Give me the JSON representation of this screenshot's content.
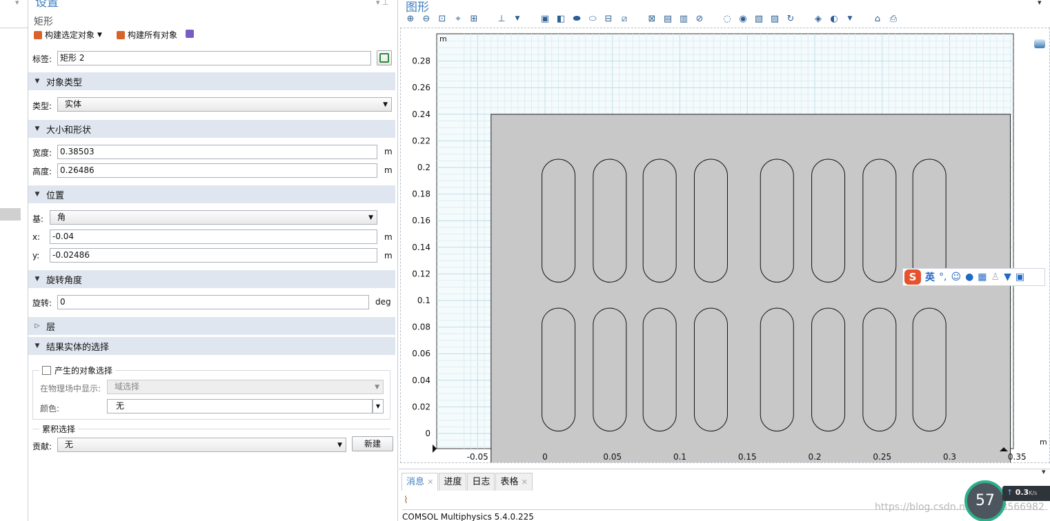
{
  "left_panel": {
    "collapse_glyph": "▾"
  },
  "settings": {
    "title": "设置",
    "subtitle": "矩形",
    "toolbar": {
      "build_selected": "构建选定对象",
      "build_all": "构建所有对象"
    },
    "label_field": {
      "label": "标签:",
      "value": "矩形 2"
    },
    "sections": {
      "object_type": "对象类型",
      "size_shape": "大小和形状",
      "position": "位置",
      "rotation": "旋转角度",
      "layers": "层",
      "result_selection": "结果实体的选择"
    },
    "type_field": {
      "label": "类型:",
      "value": "实体"
    },
    "width_field": {
      "label": "宽度:",
      "value": "0.38503",
      "unit": "m"
    },
    "height_field": {
      "label": "高度:",
      "value": "0.26486",
      "unit": "m"
    },
    "base_field": {
      "label": "基:",
      "value": "角"
    },
    "x_field": {
      "label": "x:",
      "value": "-0.04",
      "unit": "m"
    },
    "y_field": {
      "label": "y:",
      "value": "-0.02486",
      "unit": "m"
    },
    "rotation_field": {
      "label": "旋转:",
      "value": "0",
      "unit": "deg"
    },
    "result_group": {
      "checkbox_label": "产生的对象选择",
      "show_label": "在物理场中显示:",
      "show_value": "域选择",
      "color_label": "颜色:",
      "color_value": "无"
    },
    "cumulative": {
      "group_label": "累积选择",
      "contribute_label": "贡献:",
      "contribute_value": "无",
      "new_button": "新建"
    }
  },
  "graphics": {
    "title": "图形",
    "unit_label_y": "m",
    "unit_label_x": "m",
    "y_ticks": [
      "0.28",
      "0.26",
      "0.24",
      "0.22",
      "0.2",
      "0.18",
      "0.16",
      "0.14",
      "0.12",
      "0.1",
      "0.08",
      "0.06",
      "0.04",
      "0.02",
      "0"
    ],
    "x_ticks": [
      "-0.05",
      "0",
      "0.05",
      "0.1",
      "0.15",
      "0.2",
      "0.25",
      "0.3",
      "0.35"
    ]
  },
  "messages": {
    "tabs": [
      "消息",
      "进度",
      "日志",
      "表格"
    ],
    "text": "COMSOL Multiphysics 5.4.0.225"
  },
  "ime": {
    "mode": "英"
  },
  "overlay": {
    "gauge": "57",
    "speed": "0.3",
    "speed_unit": "K/s",
    "watermark": "https://blog.csdn.net/qq_43566982"
  },
  "colors": {
    "accent": "#3f7fbf",
    "section_bg": "#dfe6ef",
    "rect_fill": "#c8c8c8"
  }
}
